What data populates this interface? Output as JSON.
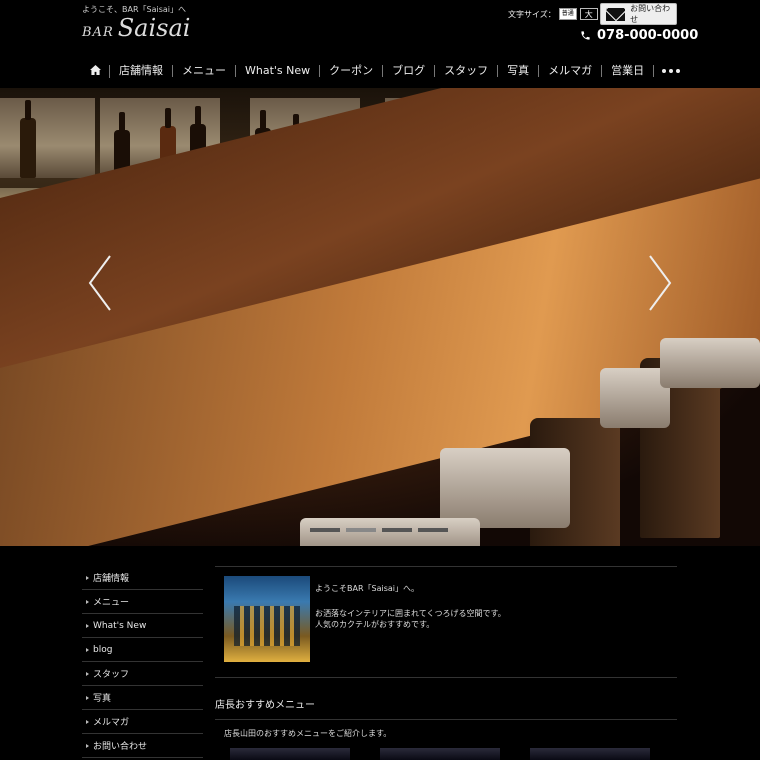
{
  "header": {
    "welcome": "ようこそ、BAR「Saisai」へ",
    "logo_bar": "BAR",
    "logo_name": "Saisai",
    "font_size_label": "文字サイズ：",
    "font_normal": "普通",
    "font_large": "大",
    "contact_label": "お問い合わせ",
    "phone": "078-000-0000"
  },
  "nav": {
    "items": [
      "店舗情報",
      "メニュー",
      "What's New",
      "クーポン",
      "ブログ",
      "スタッフ",
      "写真",
      "メルマガ",
      "営業日"
    ]
  },
  "sidebar": {
    "items": [
      "店舗情報",
      "メニュー",
      "What's New",
      "blog",
      "スタッフ",
      "写真",
      "メルマガ",
      "お問い合わせ"
    ]
  },
  "main": {
    "intro_title": "ようこそBAR「Saisai」へ。",
    "intro_line1": "お洒落なインテリアに囲まれてくつろげる空間です。",
    "intro_line2": "人気のカクテルがおすすめです。",
    "section_title": "店長おすすめメニュー",
    "section_sub": "店長山田のおすすめメニューをご紹介します。"
  },
  "colors": {
    "background": "#000000",
    "text": "#dddddd",
    "accent_wood": "#c07a3a"
  }
}
